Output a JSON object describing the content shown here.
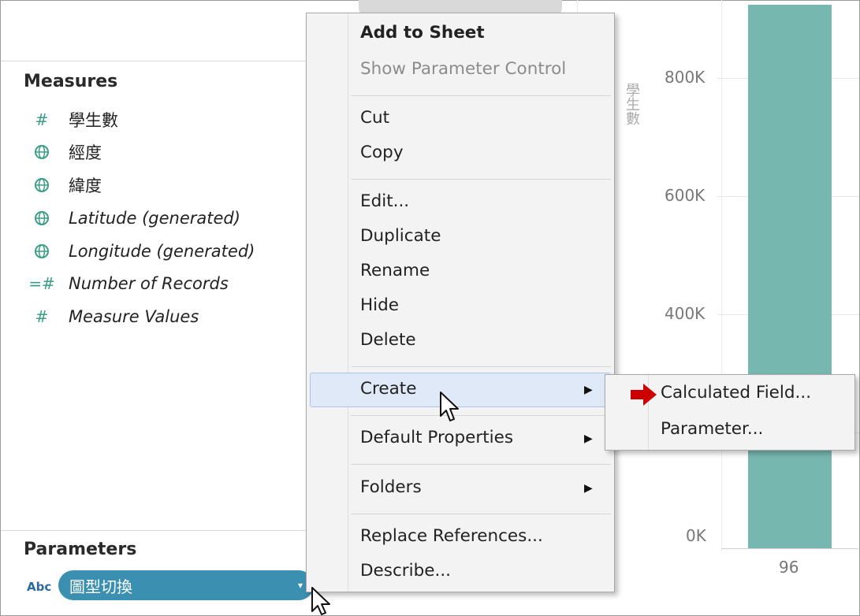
{
  "data_pane": {
    "measures_title": "Measures",
    "measures": [
      {
        "icon": "hash-icon",
        "name": "學生數",
        "italic": false
      },
      {
        "icon": "globe-icon",
        "name": "經度",
        "italic": false
      },
      {
        "icon": "globe-icon",
        "name": "緯度",
        "italic": false
      },
      {
        "icon": "globe-icon",
        "name": "Latitude (generated)",
        "italic": true
      },
      {
        "icon": "globe-icon",
        "name": "Longitude (generated)",
        "italic": true
      },
      {
        "icon": "records-hash-icon",
        "name": "Number of Records",
        "italic": true
      },
      {
        "icon": "hash-icon",
        "name": "Measure Values",
        "italic": true
      }
    ],
    "parameters_title": "Parameters",
    "parameter": {
      "type_label": "Abc",
      "name": "圖型切換"
    }
  },
  "chart": {
    "axis_title": "學生數",
    "y_ticks": [
      "800K",
      "600K",
      "400K",
      "0K"
    ],
    "x_label": "96",
    "bar_color": "#76b7b0"
  },
  "context_menu": {
    "items": [
      {
        "label": "Add to Sheet",
        "bold": true
      },
      {
        "label": "Show Parameter Control",
        "disabled": true
      },
      {
        "label": "Cut"
      },
      {
        "label": "Copy"
      },
      {
        "label": "Edit..."
      },
      {
        "label": "Duplicate"
      },
      {
        "label": "Rename"
      },
      {
        "label": "Hide"
      },
      {
        "label": "Delete"
      },
      {
        "label": "Create",
        "submenu": true,
        "highlighted": true
      },
      {
        "label": "Default Properties",
        "submenu": true
      },
      {
        "label": "Folders",
        "submenu": true
      },
      {
        "label": "Replace References..."
      },
      {
        "label": "Describe..."
      }
    ]
  },
  "submenu": {
    "items": [
      "Calculated Field...",
      "Parameter..."
    ],
    "pointer_color": "#cc0000"
  }
}
